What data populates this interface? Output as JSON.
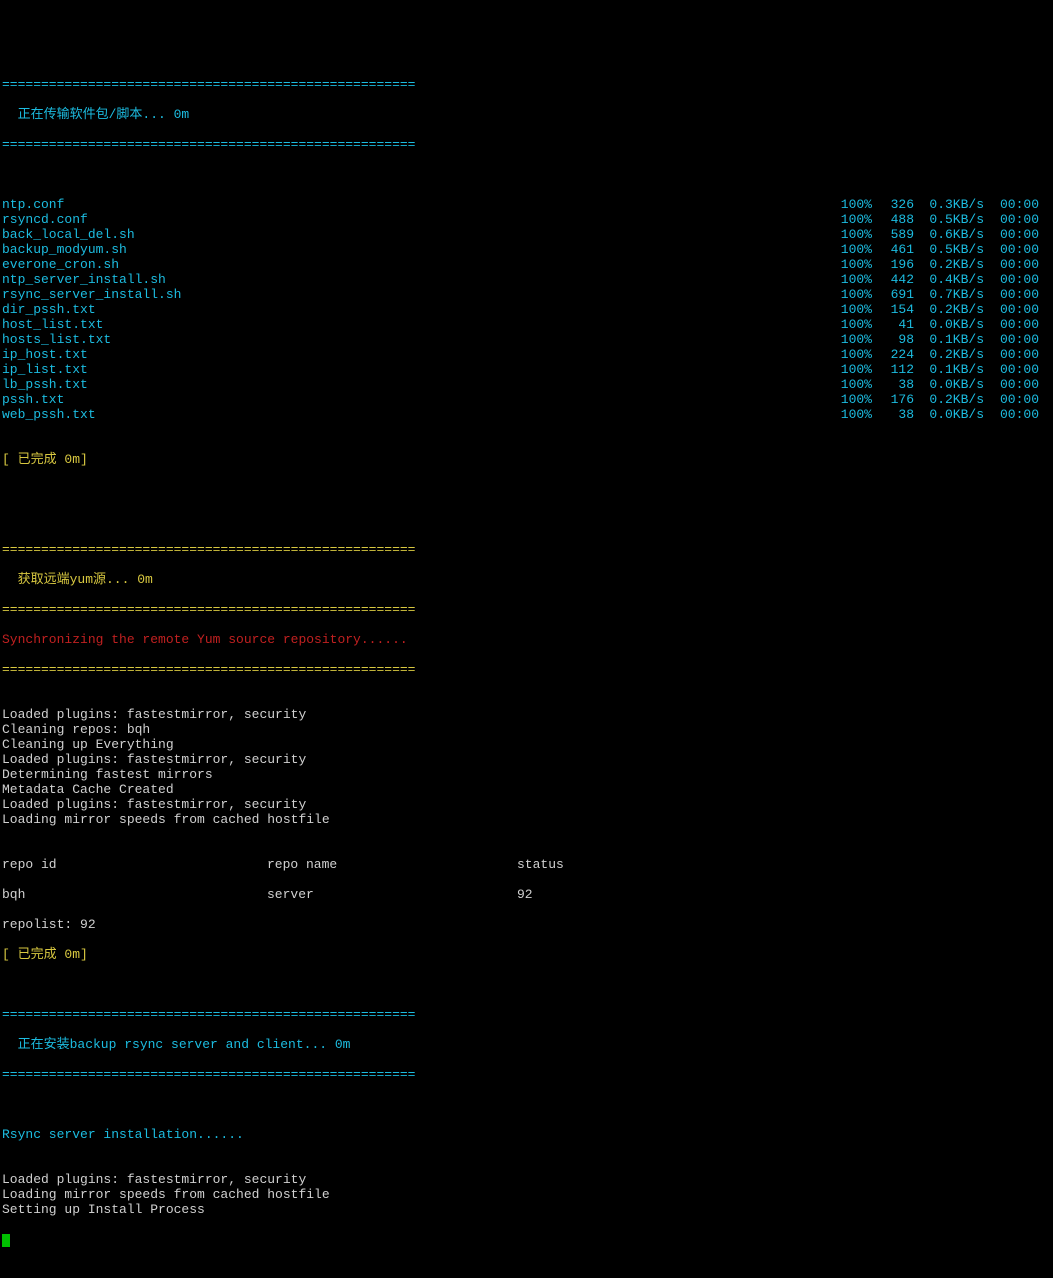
{
  "sep_line": "=====================================================",
  "section1": {
    "title": "  正在传输软件包/脚本... 0m"
  },
  "files": [
    {
      "name": "ntp.conf",
      "pct": "100%",
      "size": "326",
      "rate": "0.3KB/s",
      "time": "00:00"
    },
    {
      "name": "rsyncd.conf",
      "pct": "100%",
      "size": "488",
      "rate": "0.5KB/s",
      "time": "00:00"
    },
    {
      "name": "back_local_del.sh",
      "pct": "100%",
      "size": "589",
      "rate": "0.6KB/s",
      "time": "00:00"
    },
    {
      "name": "backup_modyum.sh",
      "pct": "100%",
      "size": "461",
      "rate": "0.5KB/s",
      "time": "00:00"
    },
    {
      "name": "everone_cron.sh",
      "pct": "100%",
      "size": "196",
      "rate": "0.2KB/s",
      "time": "00:00"
    },
    {
      "name": "ntp_server_install.sh",
      "pct": "100%",
      "size": "442",
      "rate": "0.4KB/s",
      "time": "00:00"
    },
    {
      "name": "rsync_server_install.sh",
      "pct": "100%",
      "size": "691",
      "rate": "0.7KB/s",
      "time": "00:00"
    },
    {
      "name": "dir_pssh.txt",
      "pct": "100%",
      "size": "154",
      "rate": "0.2KB/s",
      "time": "00:00"
    },
    {
      "name": "host_list.txt",
      "pct": "100%",
      "size": "41",
      "rate": "0.0KB/s",
      "time": "00:00"
    },
    {
      "name": "hosts_list.txt",
      "pct": "100%",
      "size": "98",
      "rate": "0.1KB/s",
      "time": "00:00"
    },
    {
      "name": "ip_host.txt",
      "pct": "100%",
      "size": "224",
      "rate": "0.2KB/s",
      "time": "00:00"
    },
    {
      "name": "ip_list.txt",
      "pct": "100%",
      "size": "112",
      "rate": "0.1KB/s",
      "time": "00:00"
    },
    {
      "name": "lb_pssh.txt",
      "pct": "100%",
      "size": "38",
      "rate": "0.0KB/s",
      "time": "00:00"
    },
    {
      "name": "pssh.txt",
      "pct": "100%",
      "size": "176",
      "rate": "0.2KB/s",
      "time": "00:00"
    },
    {
      "name": "web_pssh.txt",
      "pct": "100%",
      "size": "38",
      "rate": "0.0KB/s",
      "time": "00:00"
    }
  ],
  "done1": "[ 已完成 0m]",
  "section2": {
    "title": "  获取远端yum源... 0m",
    "sync_msg": "Synchronizing the remote Yum source repository......"
  },
  "loglines": [
    "Loaded plugins: fastestmirror, security",
    "Cleaning repos: bqh",
    "Cleaning up Everything",
    "Loaded plugins: fastestmirror, security",
    "Determining fastest mirrors",
    "Metadata Cache Created",
    "Loaded plugins: fastestmirror, security",
    "Loading mirror speeds from cached hostfile"
  ],
  "repo": {
    "header": {
      "c1": "repo id",
      "c2": "repo name",
      "c3": "status"
    },
    "row": {
      "c1": "bqh",
      "c2": "server",
      "c3": "92"
    },
    "repolist": "repolist: 92"
  },
  "done2": "[ 已完成 0m]",
  "section3": {
    "title": "  正在安装backup rsync server and client... 0m",
    "rsync_msg": "Rsync server installation......"
  },
  "loglines3": [
    "Loaded plugins: fastestmirror, security",
    "Loading mirror speeds from cached hostfile",
    "Setting up Install Process"
  ]
}
